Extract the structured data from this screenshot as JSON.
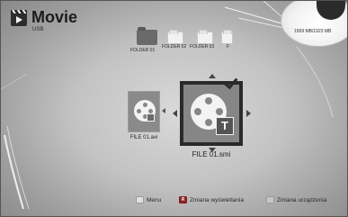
{
  "header": {
    "title": "Movie",
    "subtitle": "USB"
  },
  "storage": {
    "text": "1509 MB/1923 MB"
  },
  "folders": [
    {
      "label": "FOLDER 01"
    },
    {
      "label": "FOLDER 02"
    },
    {
      "label": "FOLDER 03"
    },
    {
      "label": "F"
    }
  ],
  "files": [
    {
      "label": "FILE 01.avi",
      "icon": "film-reel-icon"
    },
    {
      "label": "FILE 01.smi",
      "icon": "film-reel-subtitle-icon",
      "badge": "T",
      "selected": true
    }
  ],
  "footer": {
    "menu_label": "Menu",
    "red_key_label": "R",
    "change_view_label": "Zmiana wyświetlania",
    "change_device_label": "Zmiana urządzenia"
  },
  "colors": {
    "red_key": "#8a1f1f",
    "green_key": "#c7c7c7",
    "menu_key": "#e0e0e0"
  }
}
